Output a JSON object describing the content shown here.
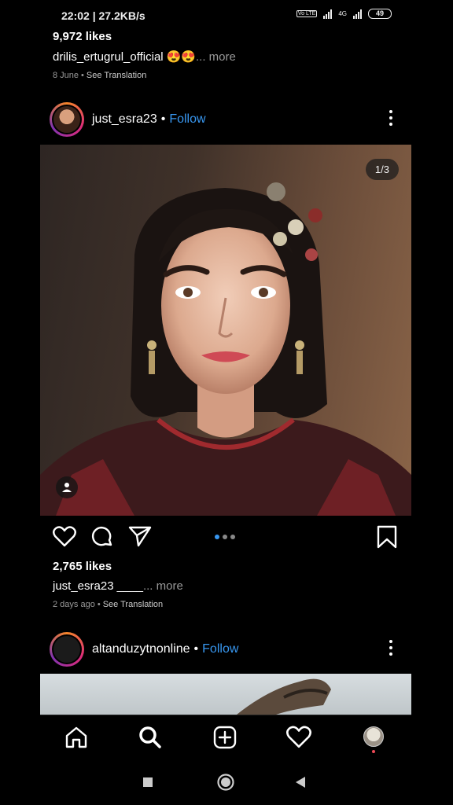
{
  "status_bar": {
    "time_speed": "22:02 | 27.2KB/s",
    "volte_tag": "Vo LTE",
    "net_tag": "4G",
    "battery": "49"
  },
  "prev_post": {
    "likes": "9,972 likes",
    "caption_user": "drilis_ertugrul_official",
    "caption_emoji": "😍😍",
    "more": "... more",
    "date": "8 June",
    "dot": "•",
    "see_translation": "See Translation"
  },
  "post": {
    "username": "just_esra23",
    "dot": "•",
    "follow": "Follow",
    "counter": "1/3",
    "likes": "2,765 likes",
    "caption_user": "just_esra23",
    "caption_text": "____",
    "more": "... more",
    "date": "2 days ago",
    "dot2": "•",
    "see_translation": "See Translation"
  },
  "next_post": {
    "username": "altanduzytnonline",
    "dot": "•",
    "follow": "Follow"
  },
  "icons": {
    "like": "heart-icon",
    "comment": "comment-icon",
    "share": "send-icon",
    "save": "bookmark-icon",
    "home": "home-icon",
    "search": "search-icon",
    "new_post": "plus-square-icon",
    "activity": "heart-icon",
    "profile": "profile-avatar"
  },
  "colors": {
    "accent": "#3897f0",
    "background": "#000000",
    "notification": "#ed4956"
  }
}
